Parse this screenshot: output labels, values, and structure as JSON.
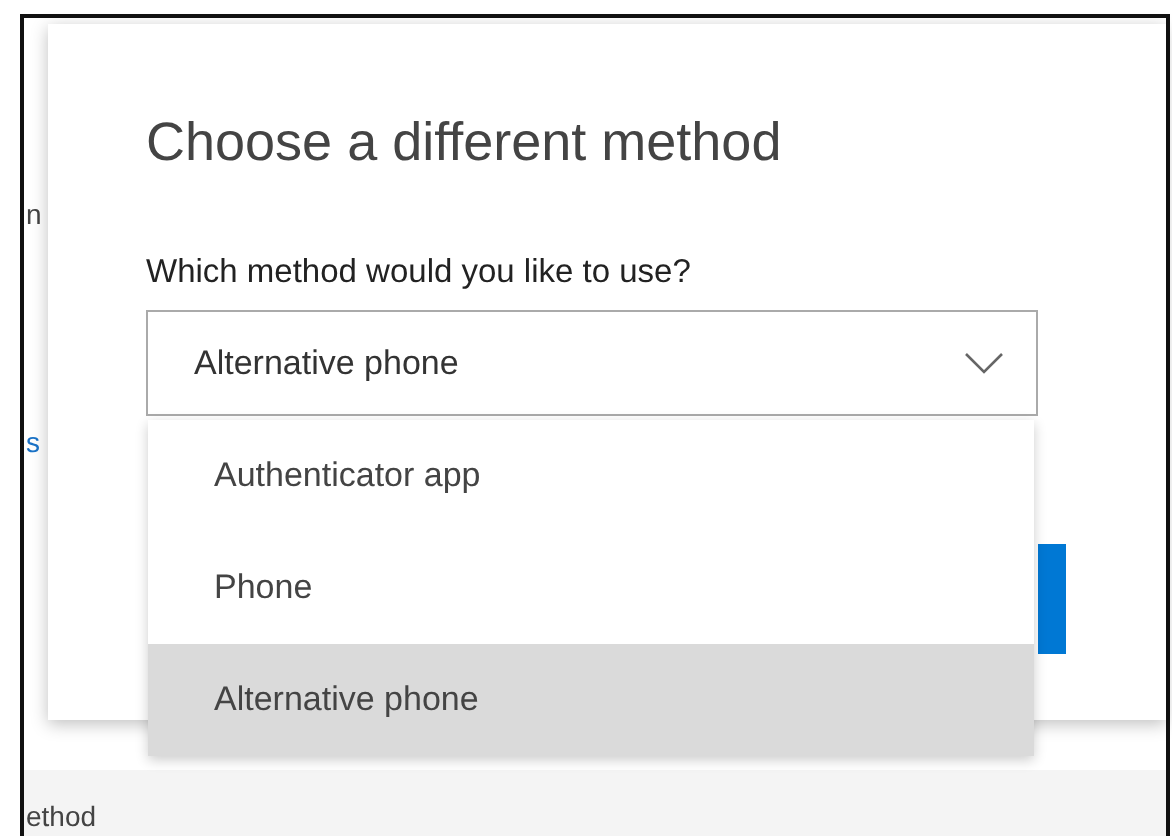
{
  "background": {
    "fragments": [
      {
        "text": "n",
        "kind": "text"
      },
      {
        "text": "s",
        "kind": "link"
      },
      {
        "text": "ethod",
        "kind": "text"
      }
    ]
  },
  "dialog": {
    "title": "Choose a different method",
    "label": "Which method would you like to use?",
    "select": {
      "value": "Alternative phone",
      "expanded": true
    },
    "options": [
      {
        "label": "Authenticator app",
        "selected": false
      },
      {
        "label": "Phone",
        "selected": false
      },
      {
        "label": "Alternative phone",
        "selected": true
      }
    ]
  }
}
